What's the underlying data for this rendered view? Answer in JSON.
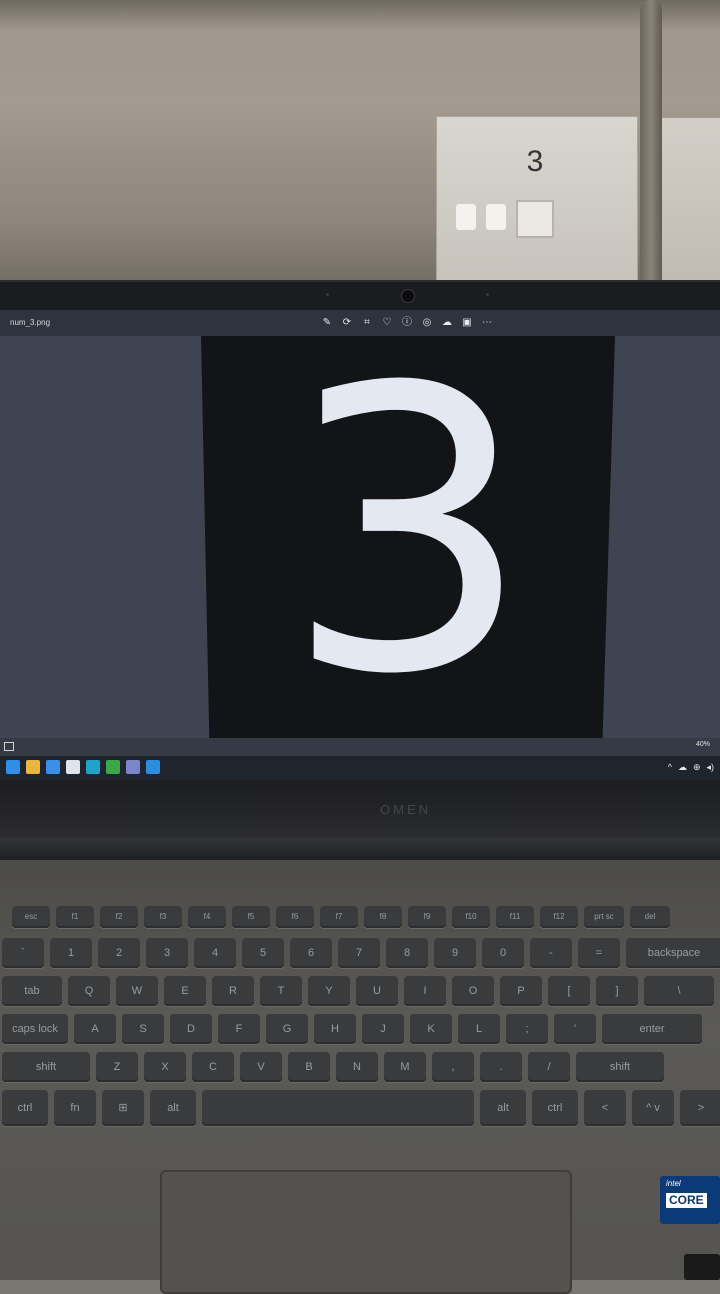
{
  "room": {
    "wall_label": "3"
  },
  "viewer": {
    "file_name": "num_3.png",
    "toolbar_icons": [
      "edit-icon",
      "rotate-icon",
      "crop-icon",
      "favorite-icon",
      "info-icon",
      "copilot-icon",
      "share-icon",
      "onedrive-icon",
      "more-icon"
    ],
    "displayed_digit": "3",
    "zoom_level": "40%"
  },
  "taskbar": {
    "apps": [
      {
        "name": "start-icon",
        "color": "#2f8ee6"
      },
      {
        "name": "file-explorer-icon",
        "color": "#e8b73b"
      },
      {
        "name": "tasks-icon",
        "color": "#3a8fe8"
      },
      {
        "name": "store-icon",
        "color": "#dfe4ea"
      },
      {
        "name": "edge-icon",
        "color": "#1fa3c9"
      },
      {
        "name": "app-icon",
        "color": "#3ba84a"
      },
      {
        "name": "teams-icon",
        "color": "#7a86c9"
      },
      {
        "name": "photos-icon",
        "color": "#2b8fe0"
      }
    ],
    "tray": [
      "^",
      "☁",
      "⊕",
      "◂)"
    ]
  },
  "laptop": {
    "brand": "OMEN"
  },
  "keyboard_rows": [
    [
      "esc",
      "f1",
      "f2",
      "f3",
      "f4",
      "f5",
      "f6",
      "f7",
      "f8",
      "f9",
      "f10",
      "f11",
      "f12",
      "prt sc",
      "del"
    ],
    [
      "`",
      "1",
      "2",
      "3",
      "4",
      "5",
      "6",
      "7",
      "8",
      "9",
      "0",
      "-",
      "=",
      "backspace"
    ],
    [
      "tab",
      "Q",
      "W",
      "E",
      "R",
      "T",
      "Y",
      "U",
      "I",
      "O",
      "P",
      "[",
      "]",
      "\\"
    ],
    [
      "caps lock",
      "A",
      "S",
      "D",
      "F",
      "G",
      "H",
      "J",
      "K",
      "L",
      ";",
      "'",
      "enter"
    ],
    [
      "shift",
      "Z",
      "X",
      "C",
      "V",
      "B",
      "N",
      "M",
      ",",
      ".",
      "/",
      "shift"
    ],
    [
      "ctrl",
      "fn",
      "⊞",
      "alt",
      "",
      "alt",
      "ctrl",
      "<",
      "^ v",
      ">"
    ]
  ],
  "sticker": {
    "brand": "intel",
    "line": "CORE"
  }
}
